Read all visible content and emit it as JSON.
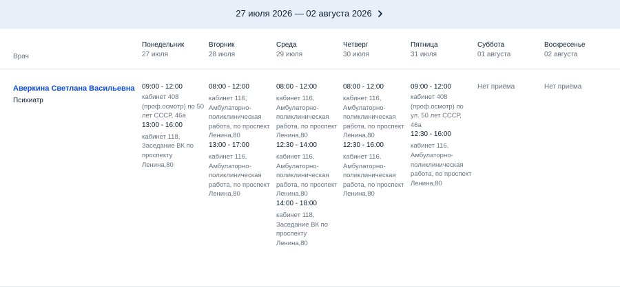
{
  "header": {
    "range": "27 июля 2026 — 02 августа 2026",
    "next_icon": "chevron-right-icon"
  },
  "columns": {
    "doctor": "Врач",
    "days": [
      {
        "name": "Понедельник",
        "date": "27 июля"
      },
      {
        "name": "Вторник",
        "date": "28 июля"
      },
      {
        "name": "Среда",
        "date": "29 июля"
      },
      {
        "name": "Четверг",
        "date": "30 июля"
      },
      {
        "name": "Пятница",
        "date": "31 июля"
      },
      {
        "name": "Суббота",
        "date": "01 августа"
      },
      {
        "name": "Воскресенье",
        "date": "02 августа"
      }
    ]
  },
  "doctor": {
    "name": "Аверкина Светлана Васильевна",
    "specialty": "Психиатр"
  },
  "schedule": [
    {
      "slots": [
        {
          "time": "09:00 - 12:00",
          "place": "кабинет 408 (проф.осмотр) по 50 лет СССР, 46а"
        },
        {
          "time": "13:00 - 16:00",
          "place": "кабинет 118, Заседание ВК по проспекту Ленина,80"
        }
      ]
    },
    {
      "slots": [
        {
          "time": "08:00 - 12:00",
          "place": "кабинет 116, Амбулаторно-поликлиническая работа, по проспект Ленина,80"
        },
        {
          "time": "13:00 - 17:00",
          "place": "кабинет 116, Амбулаторно-поликлиническая работа, по проспект Ленина,80"
        }
      ]
    },
    {
      "slots": [
        {
          "time": "08:00 - 12:00",
          "place": "кабинет 116, Амбулаторно-поликлиническая работа, по проспект Ленина,80"
        },
        {
          "time": "12:30 - 14:00",
          "place": "кабинет 116, Амбулаторно-поликлиническая работа, по проспект Ленина,80"
        },
        {
          "time": "14:00 - 18:00",
          "place": "кабинет 118, Заседание ВК по проспекту Ленина,80"
        }
      ]
    },
    {
      "slots": [
        {
          "time": "08:00 - 12:00",
          "place": "кабинет 116, Амбулаторно-поликлиническая работа, по проспект Ленина,80"
        },
        {
          "time": "12:30 - 16:00",
          "place": "кабинет 116, Амбулаторно-поликлиническая работа, по проспект Ленина,80"
        }
      ]
    },
    {
      "slots": [
        {
          "time": "09:00 - 12:00",
          "place": "кабинет 408 (проф.осмотр) по ул. 50 лет СССР, 46а"
        },
        {
          "time": "12:30 - 16:00",
          "place": "кабинет 116, Амбулаторно-поликлиническая работа, по проспект Ленина,80"
        }
      ]
    },
    {
      "slots": [],
      "empty": "Нет приёма"
    },
    {
      "slots": [],
      "empty": "Нет приёма"
    }
  ]
}
